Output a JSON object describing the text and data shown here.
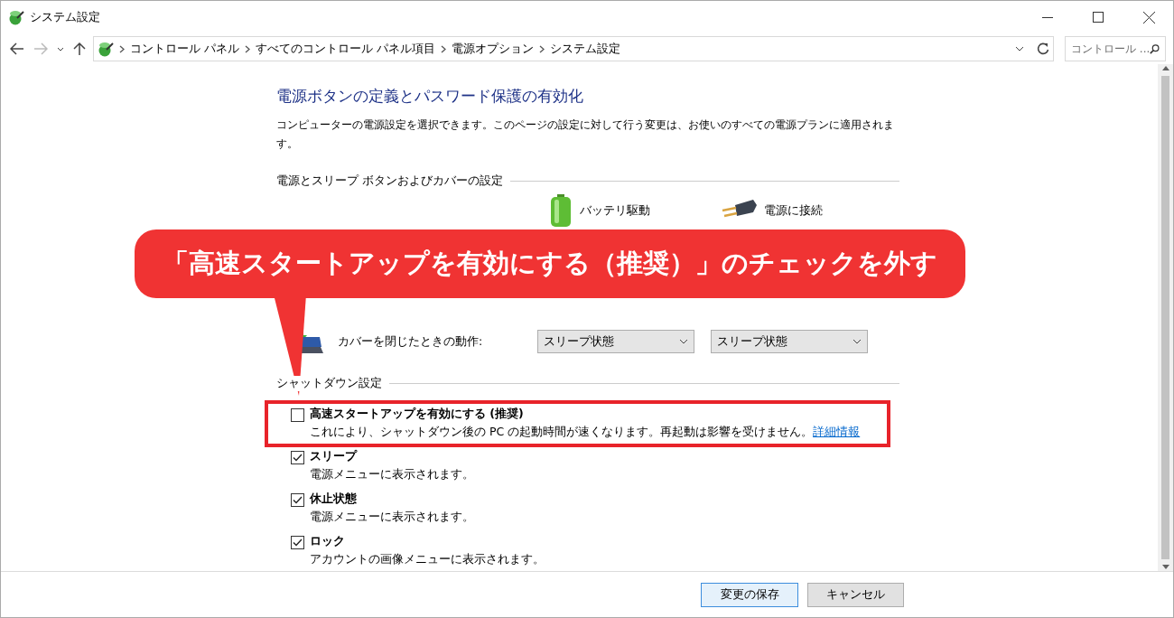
{
  "window": {
    "title": "システム設定"
  },
  "address_bar": {
    "breadcrumbs": [
      "コントロール パネル",
      "すべてのコントロール パネル項目",
      "電源オプション",
      "システム設定"
    ]
  },
  "search": {
    "placeholder": "コントロール ..."
  },
  "page": {
    "heading": "電源ボタンの定義とパスワード保護の有効化",
    "description": "コンピューターの電源設定を選択できます。このページの設定に対して行う変更は、お使いのすべての電源プランに適用されます。",
    "power_section": {
      "title": "電源とスリープ ボタンおよびカバーの設定",
      "columns": [
        {
          "label": "バッテリ駆動",
          "kind": "battery"
        },
        {
          "label": "電源に接続",
          "kind": "plug"
        }
      ],
      "rows": [
        {
          "label": "カバーを閉じたときの動作:",
          "kind": "lid",
          "values": [
            "スリープ状態",
            "スリープ状態"
          ]
        }
      ]
    },
    "shutdown_section": {
      "title": "シャットダウン設定",
      "options": [
        {
          "label": "高速スタートアップを有効にする (推奨)",
          "description": "これにより、シャットダウン後の PC の起動時間が速くなります。再起動は影響を受けません。",
          "link": "詳細情報",
          "checked": false,
          "highlighted": true
        },
        {
          "label": "スリープ",
          "description": "電源メニューに表示されます。",
          "checked": true,
          "highlighted": false
        },
        {
          "label": "休止状態",
          "description": "電源メニューに表示されます。",
          "checked": true,
          "highlighted": false
        },
        {
          "label": "ロック",
          "description": "アカウントの画像メニューに表示されます。",
          "checked": true,
          "highlighted": false
        }
      ]
    }
  },
  "buttons": [
    {
      "label": "変更の保存",
      "kind": "primary"
    },
    {
      "label": "キャンセル",
      "kind": "secondary"
    }
  ],
  "callout": {
    "text": "「高速スタートアップを有効にする（推奨）」のチェックを外す"
  }
}
